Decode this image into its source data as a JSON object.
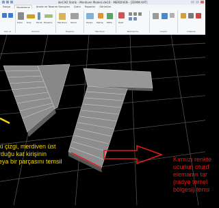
{
  "window": {
    "title": "ideCAD Statik - Merdiven Modeli.ide10 - MERDIVEN - [ZEMIN KAT]"
  },
  "ribbon": {
    "tabs": [
      "Dosya",
      "Modelleme",
      "Analiz ve Tasarım Sonuçları",
      "Çizim",
      "Raporlar",
      "Görünüm"
    ],
    "groups": [
      "Geri Al",
      "Eleman",
      "Döşeme",
      "Merdiven",
      "Betonarme",
      "Araçlar",
      "Düzenle"
    ],
    "labels": [
      "Kolon",
      "Kiriş",
      "Perde",
      "Döşeme",
      "Merdiven",
      "Temel",
      "Radye",
      "Metraj",
      "Pafta",
      "Kesit"
    ]
  },
  "annotations": {
    "left": [
      "ki çizgi, merdiven üst",
      "rduğu kat kirişinin",
      "eya bir parçasını temsil"
    ],
    "right": [
      "Kırmızı renkte",
      "ucunun oturd",
      "elemanın tar",
      "(radye temel",
      "bölgesi) tems"
    ]
  },
  "colors": {
    "viewport_background": "#000000",
    "grid": "#5a5a5a",
    "stair": "#8d8d8d",
    "yellow_marker": "#f2d70a",
    "red_marker": "#e01b1b"
  },
  "icons": [
    "undo-icon",
    "redo-icon",
    "column-icon",
    "beam-icon",
    "wall-icon",
    "slab-icon",
    "stair-icon",
    "foundation-icon",
    "raft-icon",
    "measure-icon",
    "sheet-icon",
    "section-icon",
    "settings-icon"
  ]
}
